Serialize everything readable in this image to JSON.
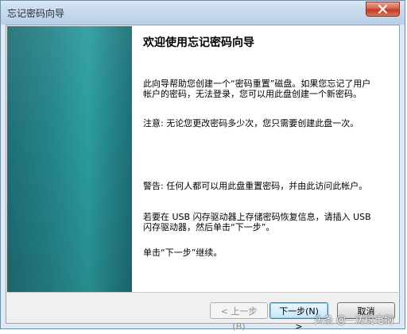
{
  "window": {
    "title": "忘记密码向导"
  },
  "content": {
    "heading": "欢迎使用忘记密码向导",
    "intro": "此向导帮助您创建一个“密码重置”磁盘。如果您忘记了用户帐户的密码，无法登录，您可以用此盘创建一个新密码。",
    "note": "注意: 无论您更改密码多少次，您只需要创建此盘一次。",
    "warning": "警告: 任何人都可以用此盘重置密码，并由此访问此帐户。",
    "usb": "若要在 USB 闪存驱动器上存储密码恢复信息，请插入 USB 闪存驱动器，然后单击“下一步”。",
    "continue": "单击“下一步”继续。"
  },
  "buttons": {
    "back_label": "< 上一步(B)",
    "next_label": "下一步(N) >",
    "cancel_label": "取消"
  },
  "watermark": "头条 @一涛说电脑",
  "colors": {
    "side_panel": "#24858a",
    "close_button": "#c23a20",
    "default_button_border": "#3c7fb1"
  }
}
